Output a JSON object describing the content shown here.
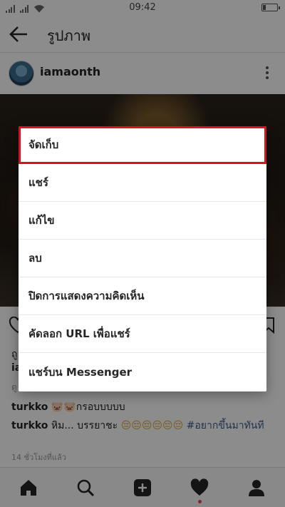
{
  "status_bar": {
    "time": "09:42",
    "battery_level": 0.2
  },
  "app_bar": {
    "title": "รูปภาพ",
    "back_icon": "arrow-left-icon"
  },
  "post": {
    "username": "iamaonth",
    "likes_text": "ถู",
    "caption_user": "ia",
    "view_all_text": "ดู",
    "comments": [
      {
        "user": "turkko",
        "text": "กรอบบบบบ",
        "emoji": "🐷🐷"
      },
      {
        "user": "turkko",
        "text": "หิม... บรรยาชะ",
        "emoji": "😔😔😔😔😔😔",
        "tag": "#อยากขึ้นมาทันที"
      }
    ],
    "timestamp": "14 ชั่วโมงที่แล้ว"
  },
  "menu": {
    "items": [
      {
        "label": "จัดเก็บ",
        "highlighted": true
      },
      {
        "label": "แชร์"
      },
      {
        "label": "แก้ไข"
      },
      {
        "label": "ลบ"
      },
      {
        "label": "ปิดการแสดงความคิดเห็น"
      },
      {
        "label": "คัดลอก URL เพื่อแชร์"
      },
      {
        "label": "แชร์บน Messenger"
      }
    ]
  },
  "bottom_nav": [
    "home-icon",
    "search-icon",
    "add-post-icon",
    "activity-heart-icon",
    "profile-icon"
  ],
  "colors": {
    "highlight": "#d4141f",
    "notification_dot": "#ed4956",
    "hashtag": "#3b5e8c"
  }
}
